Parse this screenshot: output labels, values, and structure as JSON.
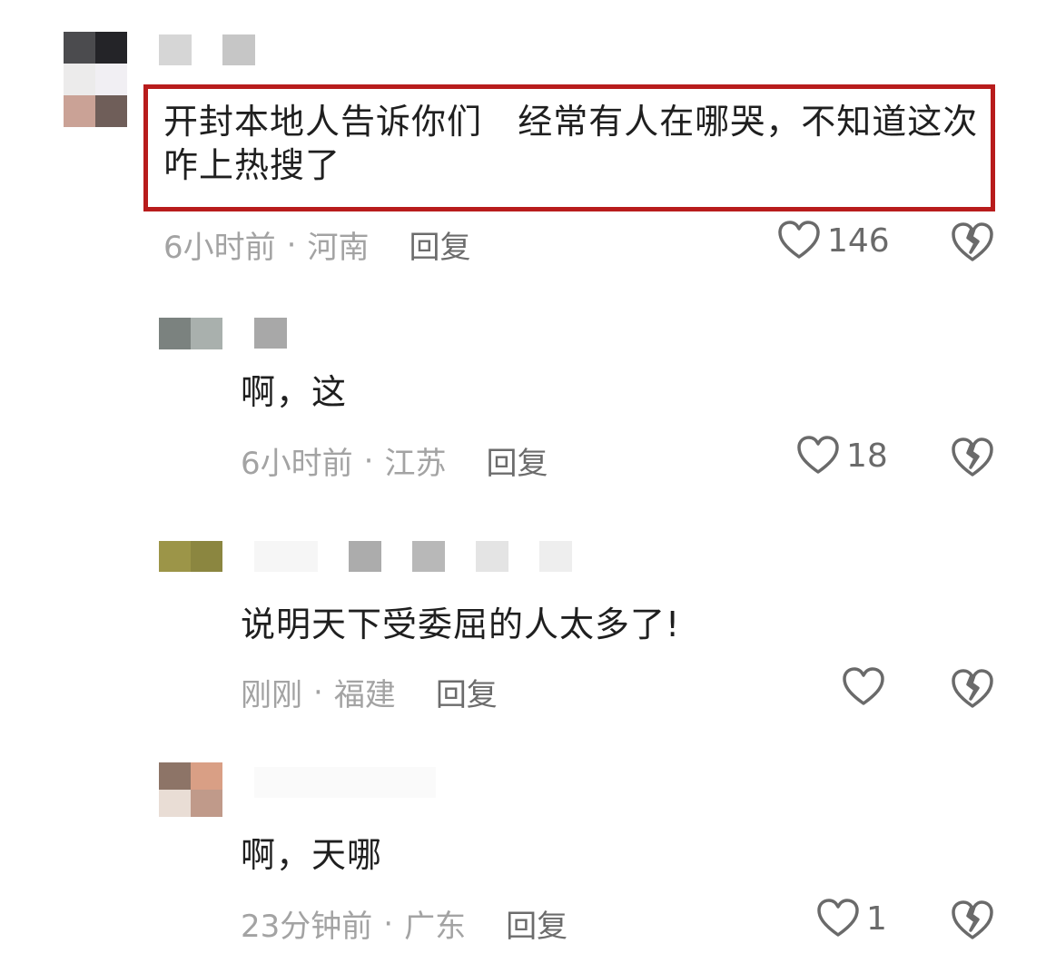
{
  "comments": [
    {
      "text": "开封本地人告诉你们   经常有人在哪哭，不知道这次咋上热搜了",
      "time": "6小时前",
      "location": "河南",
      "reply_label": "回复",
      "likes": "146",
      "highlighted": true
    },
    {
      "text": "啊，这",
      "time": "6小时前",
      "location": "江苏",
      "reply_label": "回复",
      "likes": "18"
    },
    {
      "text": "说明天下受委屈的人太多了!",
      "time": "刚刚",
      "location": "福建",
      "reply_label": "回复",
      "likes": ""
    },
    {
      "text": "啊，天哪",
      "time": "23分钟前",
      "location": "广东",
      "reply_label": "回复",
      "likes": "1"
    }
  ],
  "separator": "·",
  "colors": {
    "highlight_border": "#b81c1c",
    "meta_text": "#a3a3a3",
    "reply_text": "#6c6c6c",
    "icon_stroke": "#6a6a6a"
  },
  "icons": {
    "like": "heart-outline-icon",
    "dislike": "broken-heart-icon"
  }
}
